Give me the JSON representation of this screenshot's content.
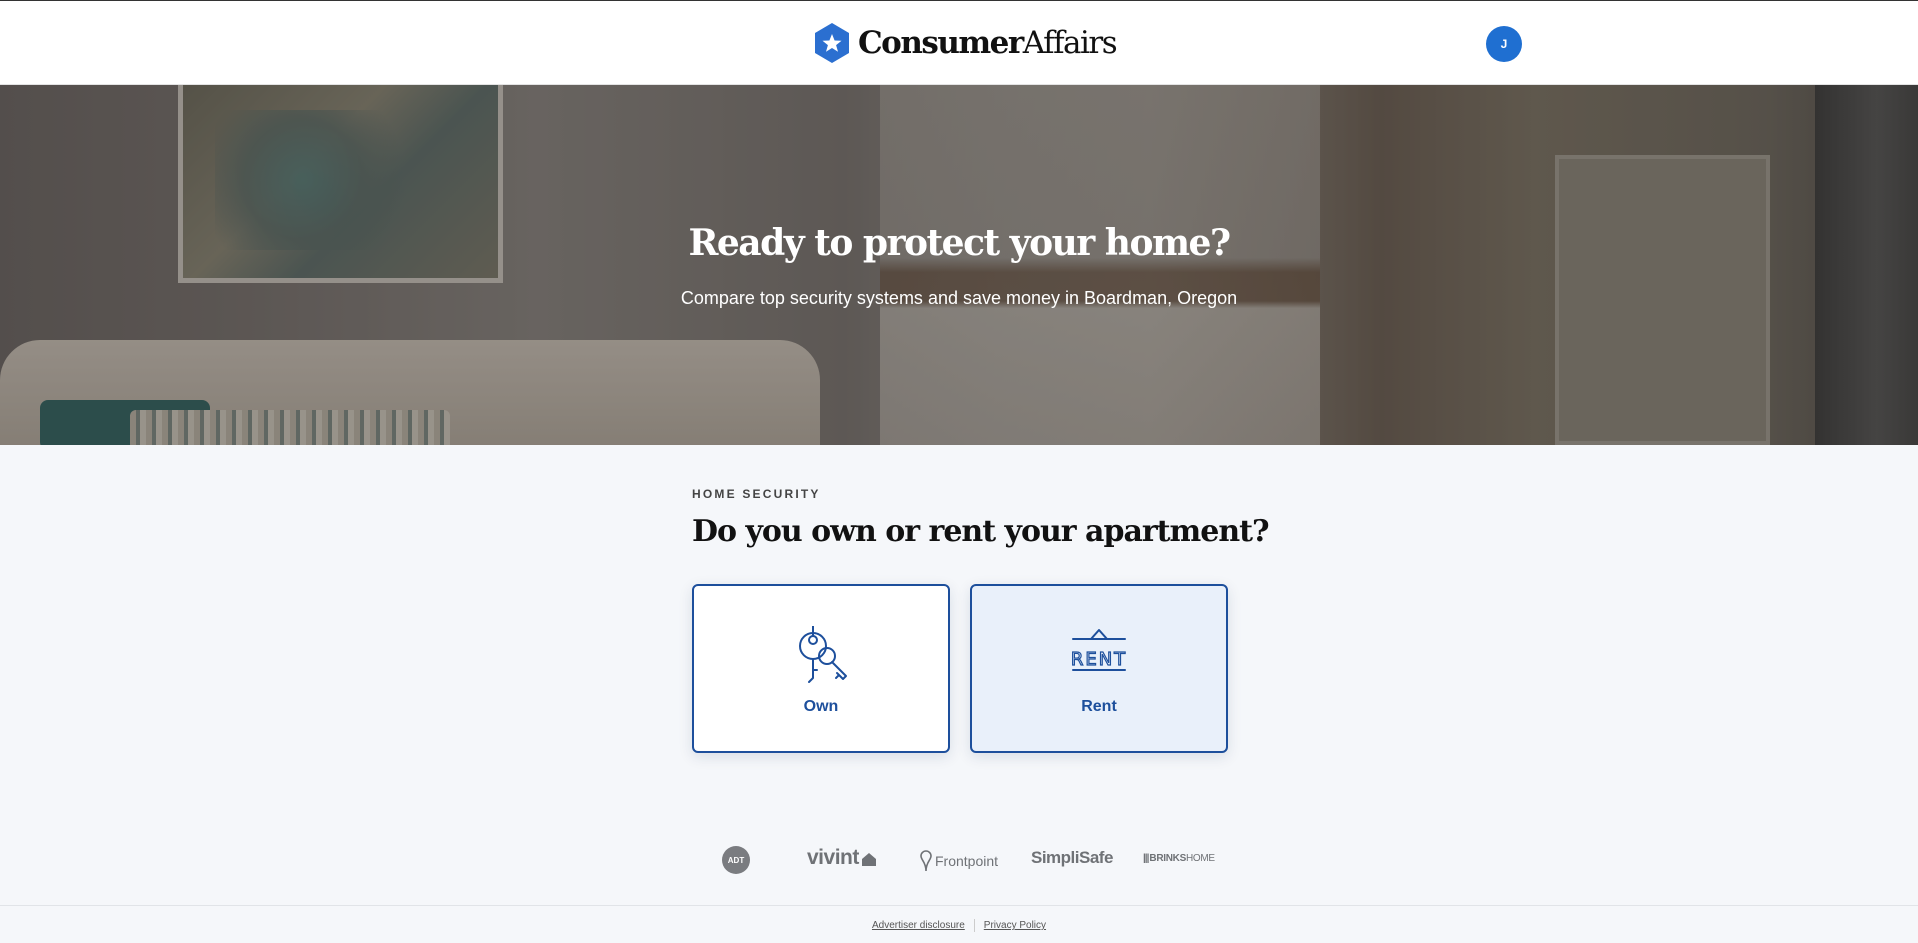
{
  "header": {
    "logo_bold": "Consumer",
    "logo_light": "Affairs",
    "avatar_initial": "J"
  },
  "hero": {
    "title": "Ready to protect your home?",
    "subtitle": "Compare top security systems and save money in Boardman, Oregon"
  },
  "main": {
    "eyebrow": "HOME SECURITY",
    "question": "Do you own or rent your apartment?",
    "options": [
      {
        "label": "Own",
        "icon": "keys-icon",
        "selected": false
      },
      {
        "label": "Rent",
        "icon": "rent-sign-icon",
        "selected": true
      }
    ],
    "rent_sign_text": "RENT"
  },
  "brands": {
    "adt": "ADT",
    "vivint": "vivint",
    "frontpoint": "Frontpoint",
    "simplisafe": "SimpliSafe",
    "brinks_bold": "BRINKS",
    "brinks_light": "HOME"
  },
  "footer": {
    "advertiser_disclosure": "Advertiser disclosure",
    "privacy_policy": "Privacy Policy"
  },
  "colors": {
    "brand_blue": "#1f6fd1",
    "option_border": "#1d4f9c",
    "selected_bg": "#e9f0fa",
    "page_bg": "#f5f7fa"
  }
}
